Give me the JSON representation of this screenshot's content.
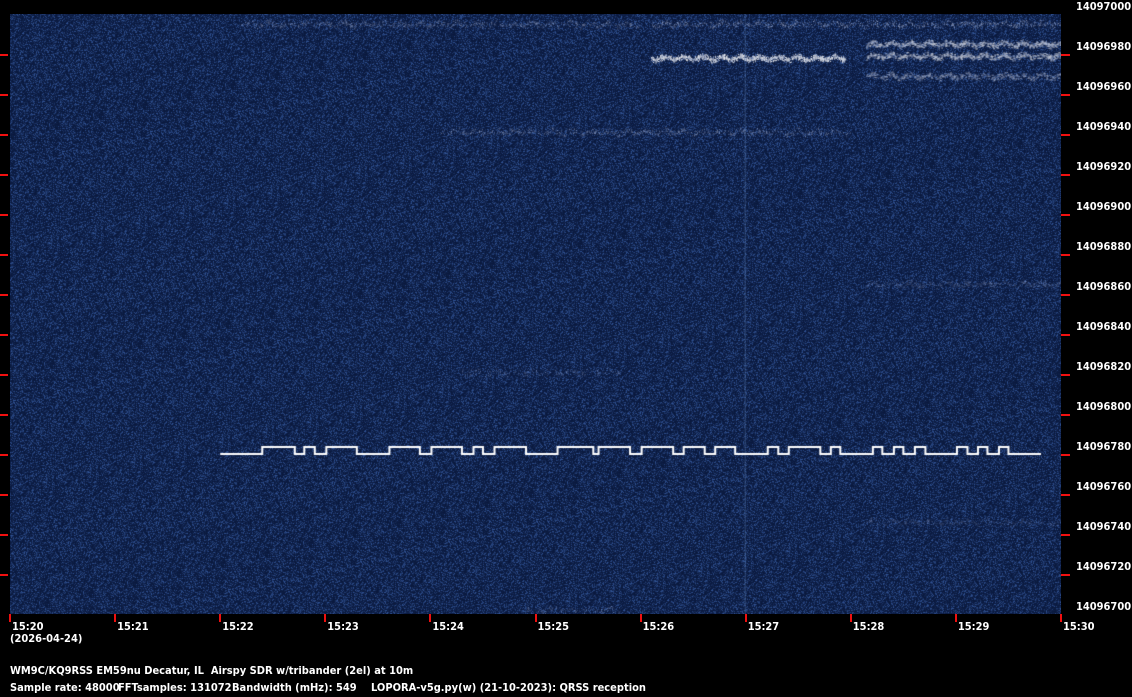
{
  "colors": {
    "background": "#000000",
    "plot": "#0a1a40",
    "trace": "#ffffff",
    "tick": "#f01010"
  },
  "y_axis": {
    "unit": "Hz",
    "min": 14096700,
    "max": 14097000,
    "labels": [
      "14097000",
      "14096980",
      "14096960",
      "14096940",
      "14096920",
      "14096900",
      "14096880",
      "14096860",
      "14096840",
      "14096820",
      "14096800",
      "14096780",
      "14096760",
      "14096740",
      "14096720",
      "14096700"
    ]
  },
  "x_axis": {
    "start_min": 0,
    "end_min": 10,
    "labels": [
      "15:20",
      "15:21",
      "15:22",
      "15:23",
      "15:24",
      "15:25",
      "15:26",
      "15:27",
      "15:28",
      "15:29",
      "15:30"
    ],
    "date": "(2026-04-24)"
  },
  "info": {
    "line1": "WM9C/KQ9RSS EM59nu Decatur, IL  Airspy SDR w/tribander (2el) at 10m",
    "sample_rate": "Sample rate: 48000",
    "fft": "FFTsamples: 131072",
    "bandwidth": "Bandwidth (mHz): 549",
    "software": "LOPORA-v5g.py(w) (21-10-2023): QRSS reception"
  },
  "trace": {
    "freq_low": 14096780,
    "freq_high": 14096783.5,
    "start_min": 2.0,
    "end_min": 9.81,
    "high_segments": [
      [
        2.4,
        2.71
      ],
      [
        2.8,
        2.9
      ],
      [
        3.01,
        3.3
      ],
      [
        3.61,
        3.9
      ],
      [
        4.01,
        4.3
      ],
      [
        4.41,
        4.5
      ],
      [
        4.61,
        4.91
      ],
      [
        5.21,
        5.55
      ],
      [
        5.6,
        5.9
      ],
      [
        6.01,
        6.31
      ],
      [
        6.41,
        6.61
      ],
      [
        6.71,
        6.9
      ],
      [
        7.21,
        7.31
      ],
      [
        7.41,
        7.71
      ],
      [
        7.81,
        7.9
      ],
      [
        8.21,
        8.3
      ],
      [
        8.41,
        8.5
      ],
      [
        8.61,
        8.71
      ],
      [
        9.01,
        9.11
      ],
      [
        9.21,
        9.3
      ],
      [
        9.41,
        9.5
      ]
    ]
  },
  "bands": [
    {
      "freq": 14096978,
      "t0": 6.1,
      "t1": 7.95,
      "strength": 1.0
    },
    {
      "freq": 14096979,
      "t0": 8.15,
      "t1": 10,
      "strength": 0.8
    },
    {
      "freq": 14096985,
      "t0": 8.15,
      "t1": 10,
      "strength": 0.8
    },
    {
      "freq": 14096969,
      "t0": 8.15,
      "t1": 10,
      "strength": 0.55
    },
    {
      "freq": 14096995,
      "t0": 2.2,
      "t1": 6,
      "strength": 0.35
    },
    {
      "freq": 14096995,
      "t0": 6.1,
      "t1": 10,
      "strength": 0.4
    },
    {
      "freq": 14096941,
      "t0": 4.1,
      "t1": 8,
      "strength": 0.35
    },
    {
      "freq": 14096865,
      "t0": 8.15,
      "t1": 10,
      "strength": 0.3
    },
    {
      "freq": 14096821,
      "t0": 4.3,
      "t1": 5.8,
      "strength": 0.25
    },
    {
      "freq": 14096746,
      "t0": 8.15,
      "t1": 10,
      "strength": 0.25
    },
    {
      "freq": 14096702,
      "t0": 4.9,
      "t1": 5.8,
      "strength": 0.25
    }
  ]
}
